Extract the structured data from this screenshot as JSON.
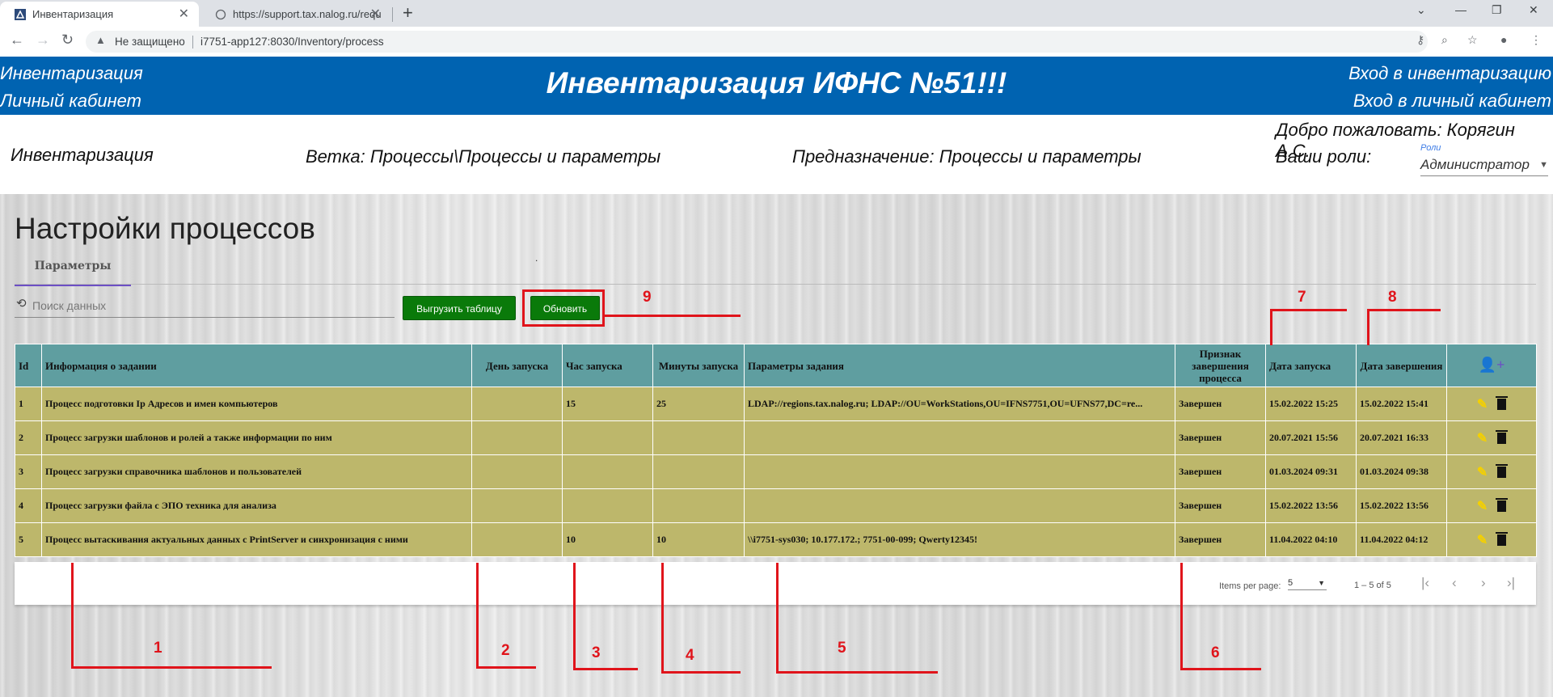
{
  "browser": {
    "tabs": [
      {
        "title": "Инвентаризация",
        "active": true
      },
      {
        "title": "https://support.tax.nalog.ru/requ",
        "active": false
      }
    ],
    "new_tab": "+",
    "security_label": "Не защищено",
    "url": "i7751-app127:8030/Inventory/process"
  },
  "header": {
    "left_link_1": "Инвентаризация",
    "left_link_2": "Личный кабинет",
    "title": "Инвентаризация ИФНС №51!!!",
    "right_link_1": "Вход в инвентаризацию",
    "right_link_2": "Вход в личный кабинет"
  },
  "info": {
    "section": "Инвентаризация",
    "branch": "Ветка: Процессы\\Процессы и параметры",
    "purpose": "Предназначение: Процессы и параметры",
    "welcome": "Добро пожаловать: Корягин А.С.",
    "roles_label": "Ваши роли:",
    "roles_field_label": "Роли",
    "roles_value": "Администратор"
  },
  "page": {
    "title": "Настройки процессов",
    "tab": "Параметры",
    "search_placeholder": "Поиск данных",
    "export_button": "Выгрузить таблицу",
    "refresh_button": "Обновить",
    "dot": "."
  },
  "table": {
    "columns": [
      "Id",
      "Информация о задании",
      "День запуска",
      "Час запуска",
      "Минуты запуска",
      "Параметры задания",
      "Признак завершения процесса",
      "Дата запуска",
      "Дата завершения"
    ],
    "rows": [
      {
        "id": "1",
        "info": "Процесс подготовки Ip Адресов и имен компьютеров",
        "day": "",
        "hour": "15",
        "minutes": "25",
        "params": "LDAP://regions.tax.nalog.ru; LDAP://OU=WorkStations,OU=IFNS7751,OU=UFNS77,DC=re...",
        "status": "Завершен",
        "start": "15.02.2022 15:25",
        "end": "15.02.2022 15:41"
      },
      {
        "id": "2",
        "info": "Процесс загрузки шаблонов и ролей а также информации по ним",
        "day": "",
        "hour": "",
        "minutes": "",
        "params": "",
        "status": "Завершен",
        "start": "20.07.2021 15:56",
        "end": "20.07.2021 16:33"
      },
      {
        "id": "3",
        "info": "Процесс загрузки справочника шаблонов и пользователей",
        "day": "",
        "hour": "",
        "minutes": "",
        "params": "",
        "status": "Завершен",
        "start": "01.03.2024 09:31",
        "end": "01.03.2024 09:38"
      },
      {
        "id": "4",
        "info": "Процесс загрузки файла с ЭПО техника для анализа",
        "day": "",
        "hour": "",
        "minutes": "",
        "params": "",
        "status": "Завершен",
        "start": "15.02.2022 13:56",
        "end": "15.02.2022 13:56"
      },
      {
        "id": "5",
        "info": "Процесс вытаскивания актуальных данных с PrintServer и синхронизация с ними",
        "day": "",
        "hour": "10",
        "minutes": "10",
        "params": "\\\\i7751-sys030; 10.177.172.; 7751-00-099; Qwerty12345!",
        "status": "Завершен",
        "start": "11.04.2022 04:10",
        "end": "11.04.2022 04:12"
      }
    ]
  },
  "paginator": {
    "items_per_page_label": "Items per page:",
    "items_per_page_value": "5",
    "range": "1 – 5 of 5"
  },
  "annotations": [
    "1",
    "2",
    "3",
    "4",
    "5",
    "6",
    "7",
    "8",
    "9"
  ],
  "colors": {
    "header_blue": "#0063b1",
    "table_header": "#5f9ea0",
    "table_row": "#bdb76b",
    "button_green": "#0a7a0a",
    "annotation_red": "#e0141b",
    "tab_underline": "#6c4fc4"
  }
}
